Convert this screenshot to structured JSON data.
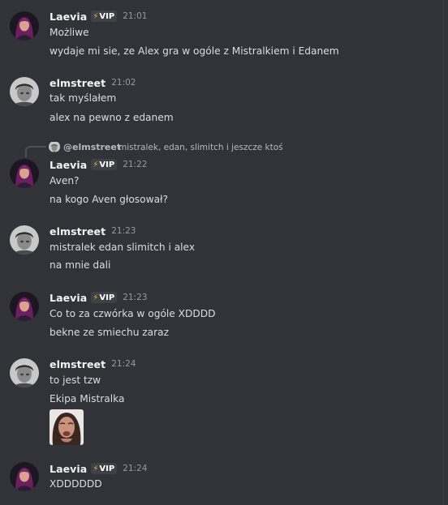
{
  "messages": [
    {
      "author": "Laevia",
      "badge": "VIP",
      "time": "21:01",
      "lines": [
        "Możliwe",
        "wydaje mi sie, ze Alex gra w ogóle z Mistralkiem i Edanem"
      ]
    },
    {
      "author": "elmstreet",
      "time": "21:02",
      "lines": [
        "tak myślałem",
        "alex na pewno z edanem"
      ]
    },
    {
      "reply": {
        "mention": "@elmstreet",
        "text": "mistralek, edan, slimitch i jeszcze ktoś"
      },
      "author": "Laevia",
      "badge": "VIP",
      "time": "21:22",
      "lines": [
        "Aven?",
        "na kogo Aven głosował?"
      ]
    },
    {
      "author": "elmstreet",
      "time": "21:23",
      "lines": [
        "mistralek edan slimitch i alex",
        "na mnie dali"
      ]
    },
    {
      "author": "Laevia",
      "badge": "VIP",
      "time": "21:23",
      "lines": [
        "Co to za czwórka w ogóle XDDDD",
        "bekne ze smiechu zaraz"
      ]
    },
    {
      "author": "elmstreet",
      "time": "21:24",
      "lines": [
        "to jest tzw",
        "Ekipa Mistralka"
      ],
      "attachment": "crying-face-sticker"
    },
    {
      "author": "Laevia",
      "badge": "VIP",
      "time": "21:24",
      "lines": [
        "XDDDDDD"
      ]
    }
  ],
  "icons": {
    "badge_icon": "lightning-bolt-icon"
  },
  "colors": {
    "background": "#313338",
    "username": "#f2f3f5",
    "text": "#dbdee1",
    "timestamp": "#949ba4",
    "bolt": "#f0b232"
  }
}
